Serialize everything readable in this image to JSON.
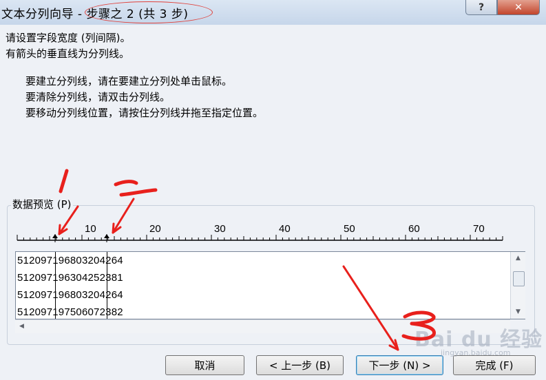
{
  "window": {
    "title_prefix": "文本分列向导 - ",
    "title_step": "步骤之 2 (共 3 步)",
    "help_label": "?",
    "close_label": "✕"
  },
  "instructions": {
    "line1": "请设置字段宽度 (列间隔)。",
    "line2": "有箭头的垂直线为分列线。",
    "line3": "要建立分列线，请在要建立分列处单击鼠标。",
    "line4": "要清除分列线，请双击分列线。",
    "line5": "要移动分列线位置，请按住分列线并拖至指定位置。"
  },
  "preview": {
    "label": "数据预览 (P)",
    "ruler_labels": [
      "10",
      "20",
      "30",
      "40",
      "50",
      "60",
      "70"
    ],
    "rows": [
      [
        "512097",
        "19680320",
        "4264"
      ],
      [
        "512097",
        "19630425",
        "2381"
      ],
      [
        "512097",
        "19680320",
        "4264"
      ],
      [
        "512097",
        "19750607",
        "2382"
      ]
    ]
  },
  "buttons": {
    "cancel": "取消",
    "back": "< 上一步 (B)",
    "next": "下一步 (N) >",
    "finish": "完成 (F)"
  },
  "annotations": {
    "mark1": "1",
    "mark2": "2",
    "mark3": "3",
    "color": "#e8201c"
  },
  "watermark": {
    "brand": "Bai du 经验",
    "sub": "jingyan.baidu.com"
  }
}
